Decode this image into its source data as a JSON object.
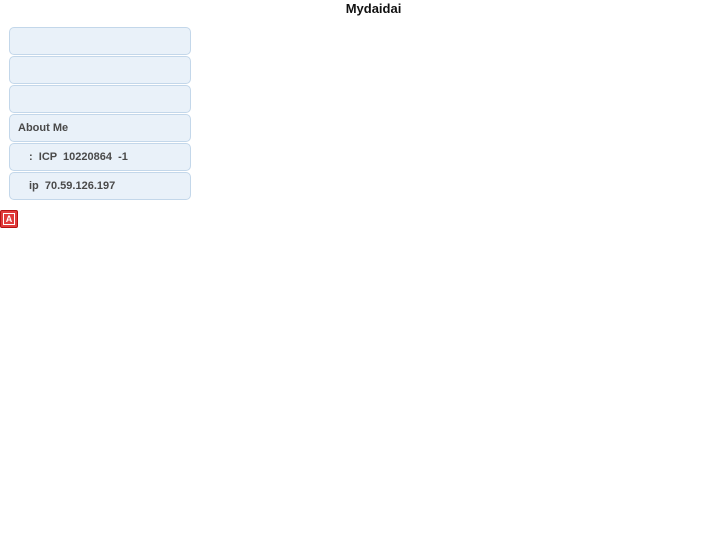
{
  "header": {
    "title": "Mydaidai"
  },
  "menu": {
    "items": [
      {
        "label": ""
      },
      {
        "label": ""
      },
      {
        "label": ""
      },
      {
        "label": "About Me"
      },
      {
        "label": ":  ICP  10220864  -1"
      },
      {
        "label": "ip  70.59.126.197"
      }
    ]
  },
  "badge": {
    "icon": "letter-a-badge-icon",
    "glyph": "A",
    "color": "#e03b3b"
  }
}
